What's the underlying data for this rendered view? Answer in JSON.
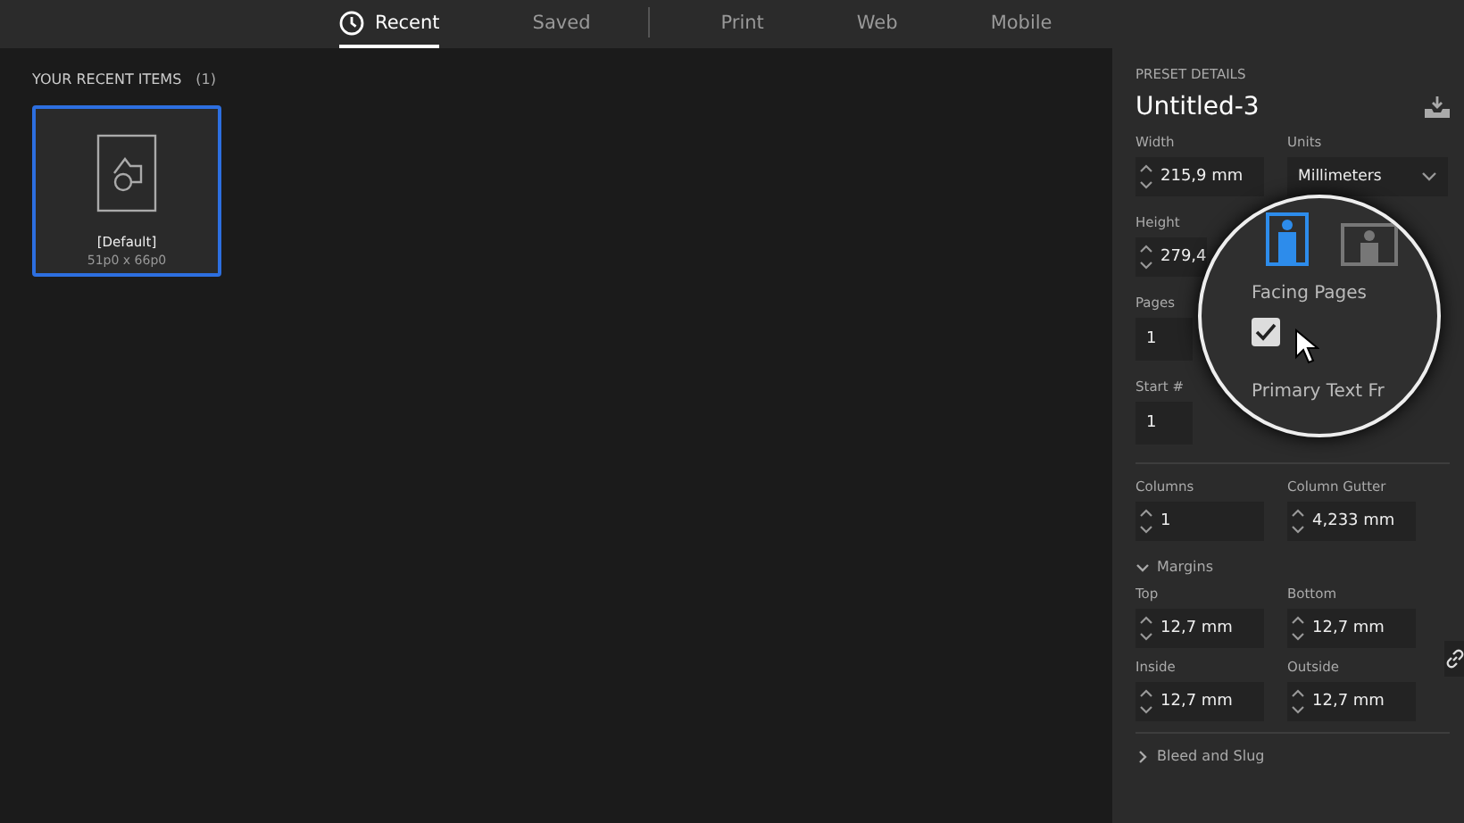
{
  "tab_groups": [
    [
      {
        "label": "Recent",
        "selected": true,
        "kind": "clock"
      },
      {
        "label": "Saved",
        "selected": false,
        "kind": "plain"
      }
    ],
    [
      {
        "label": "Print",
        "selected": false,
        "kind": "plain"
      },
      {
        "label": "Web",
        "selected": false,
        "kind": "plain"
      },
      {
        "label": "Mobile",
        "selected": false,
        "kind": "plain"
      }
    ]
  ],
  "recent": {
    "heading": "YOUR RECENT ITEMS",
    "count": "(1)",
    "items": [
      {
        "name": "[Default]",
        "size": "51p0 x 66p0",
        "selected": true
      }
    ]
  },
  "preset": {
    "heading": "PRESET DETAILS",
    "name": "Untitled-3",
    "width": {
      "label": "Width",
      "value": "215,9 mm"
    },
    "units": {
      "label": "Units",
      "value": "Millimeters"
    },
    "height": {
      "label": "Height",
      "value": "279,4"
    },
    "pages": {
      "label": "Pages",
      "value": "1"
    },
    "start": {
      "label": "Start #",
      "value": "1"
    },
    "columns": {
      "label": "Columns",
      "value": "1"
    },
    "gutter": {
      "label": "Column Gutter",
      "value": "4,233 mm"
    },
    "margins": {
      "label": "Margins",
      "expanded": true,
      "fields": [
        {
          "label": "Top",
          "value": "12,7 mm"
        },
        {
          "label": "Bottom",
          "value": "12,7 mm"
        },
        {
          "label": "Inside",
          "value": "12,7 mm"
        },
        {
          "label": "Outside",
          "value": "12,7 mm"
        }
      ]
    },
    "bleed": {
      "label": "Bleed and Slug",
      "expanded": false
    }
  },
  "magnifier": {
    "orientations": [
      {
        "kind": "portrait",
        "selected": true
      },
      {
        "kind": "landscape",
        "selected": false
      }
    ],
    "facing_pages": {
      "label": "Facing Pages",
      "checked": true
    },
    "next_label": "Primary Text Fr"
  }
}
